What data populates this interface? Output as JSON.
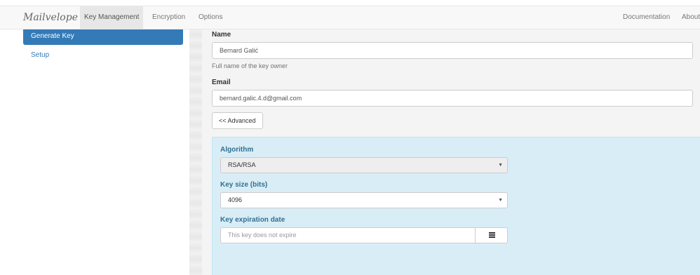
{
  "navbar": {
    "brand": "Mailvelope",
    "tabs": [
      "Key Management",
      "Encryption",
      "Options"
    ],
    "right_links": [
      "Documentation",
      "About"
    ]
  },
  "sidebar": {
    "items": [
      {
        "label": "Generate Key",
        "active": true
      },
      {
        "label": "Setup",
        "active": false
      }
    ]
  },
  "form": {
    "name_label": "Name",
    "name_value": "Bernard Galić",
    "name_help": "Full name of the key owner",
    "email_label": "Email",
    "email_value": "bernard.galic.4.d@gmail.com",
    "advanced_button": "<< Advanced"
  },
  "advanced": {
    "algorithm_label": "Algorithm",
    "algorithm_value": "RSA/RSA",
    "keysize_label": "Key size (bits)",
    "keysize_value": "4096",
    "expiration_label": "Key expiration date",
    "expiration_placeholder": "This key does not expire",
    "calendar_icon": "calendar-icon"
  },
  "colors": {
    "accent": "#337ab7",
    "panel_bg": "#d9edf7",
    "panel_label": "#31708f"
  }
}
